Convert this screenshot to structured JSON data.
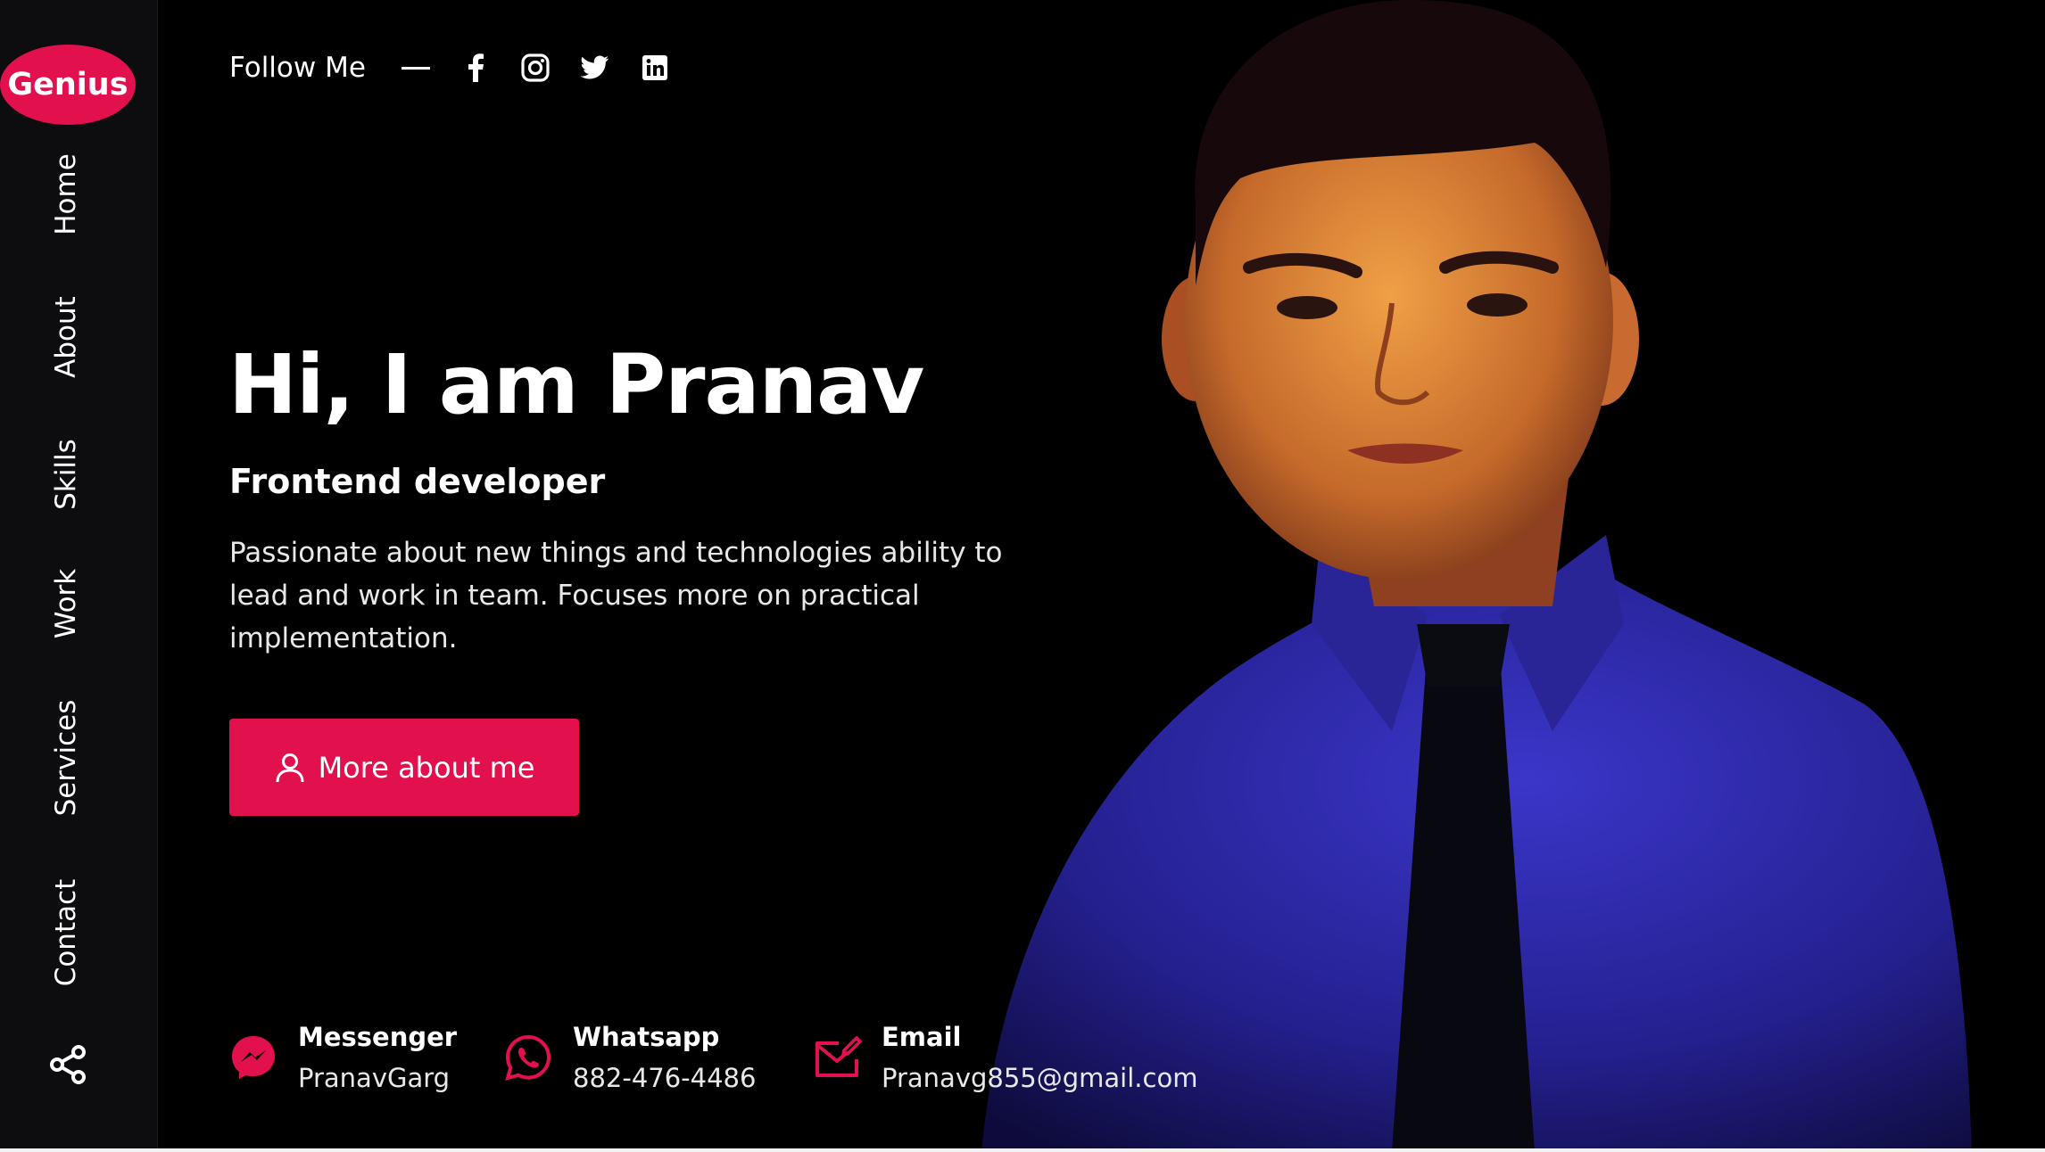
{
  "brand": {
    "logo_text": "Genius",
    "accent": "#e3104e"
  },
  "sidebar": {
    "items": [
      {
        "label": "Home"
      },
      {
        "label": "About"
      },
      {
        "label": "Skills"
      },
      {
        "label": "Work"
      },
      {
        "label": "Services"
      },
      {
        "label": "Contact"
      }
    ],
    "share_icon": "share-icon"
  },
  "follow": {
    "label": "Follow Me",
    "socials": [
      "facebook-icon",
      "instagram-icon",
      "twitter-icon",
      "linkedin-icon"
    ]
  },
  "hero": {
    "title": "Hi, I am Pranav",
    "role": "Frontend developer",
    "description": "Passionate about new things and technologies ability to lead and work in team. Focuses more on practical implementation.",
    "cta_label": "More about me",
    "cta_icon": "user-icon"
  },
  "contacts": [
    {
      "title": "Messenger",
      "value": "PranavGarg",
      "icon": "messenger-icon"
    },
    {
      "title": "Whatsapp",
      "value": "882-476-4486",
      "icon": "whatsapp-icon"
    },
    {
      "title": "Email",
      "value": "Pranavg855@gmail.com",
      "icon": "email-icon"
    }
  ]
}
